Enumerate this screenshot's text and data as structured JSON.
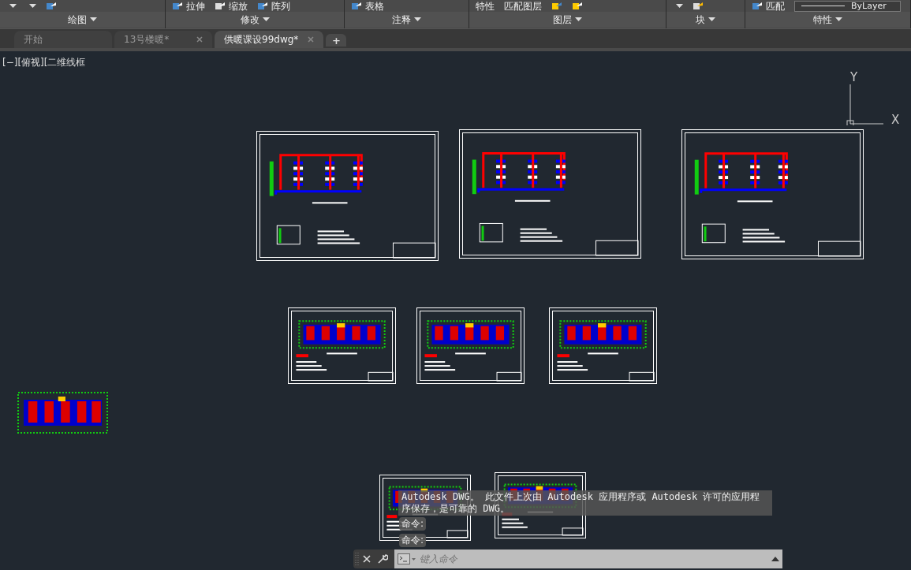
{
  "ribbon": {
    "panels": [
      {
        "label": "绘图"
      },
      {
        "label": "修改",
        "tools": [
          "拉伸",
          "缩放",
          "阵列"
        ]
      },
      {
        "label": "注释",
        "tools": [
          "表格"
        ]
      },
      {
        "label": "图层",
        "tools": [
          "特性",
          "匹配图层"
        ]
      },
      {
        "label": "块"
      },
      {
        "label": "特性",
        "tools": [
          "匹配",
          "ByLayer"
        ]
      }
    ]
  },
  "tabs": [
    {
      "label": "开始",
      "selected": false,
      "closable": false
    },
    {
      "label": "13号楼暖*",
      "selected": false,
      "closable": true
    },
    {
      "label": "供暖课设99dwg*",
      "selected": true,
      "closable": true
    }
  ],
  "new_tab": "+",
  "viewport_label": "[−][俯视][二维线框",
  "ucs": {
    "y_label": "Y",
    "x_label": "X"
  },
  "command_history": {
    "message": "Autodesk DWG。  此文件上次由 Autodesk 应用程序或 Autodesk 许可的应用程序保存，是可靠的 DWG。",
    "prompts": [
      "命令:",
      "命令:"
    ]
  },
  "command_line": {
    "placeholder": "键入命令"
  }
}
